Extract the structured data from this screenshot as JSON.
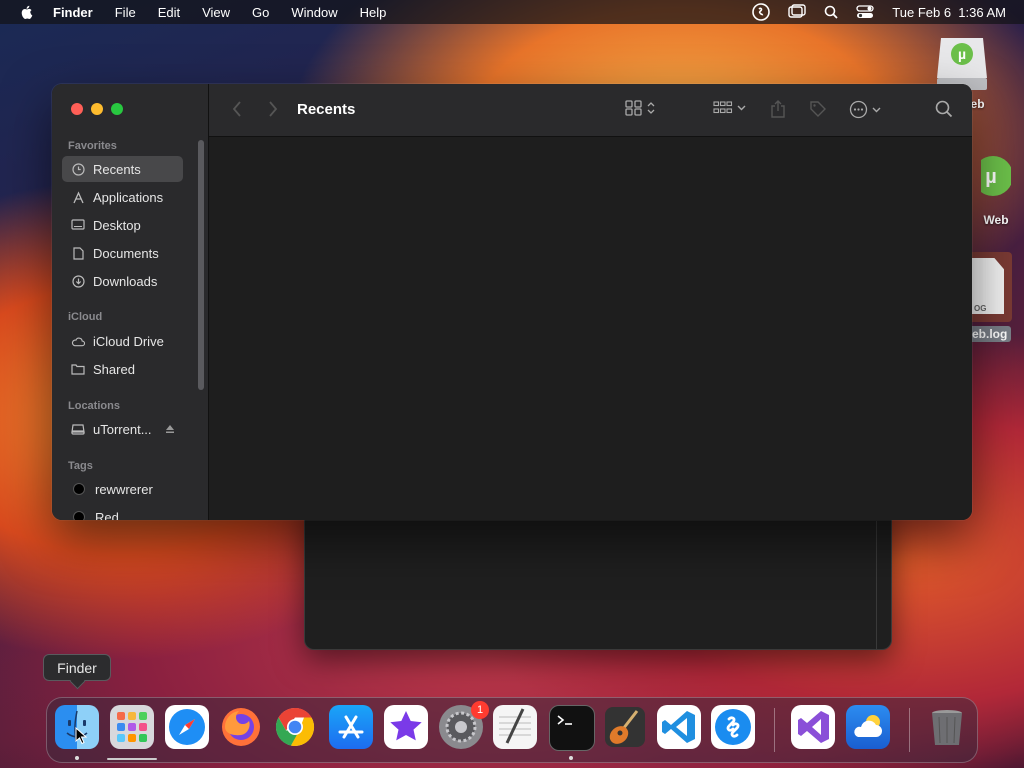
{
  "menubar": {
    "app_name": "Finder",
    "menus": [
      "File",
      "Edit",
      "View",
      "Go",
      "Window",
      "Help"
    ],
    "clock": "Tue Feb 6  1:36 AM"
  },
  "desktop": {
    "icons": [
      {
        "label": "Web"
      },
      {
        "label": "Web"
      },
      {
        "label": "eb.log",
        "doc_text": "OG"
      }
    ]
  },
  "finder": {
    "title": "Recents",
    "sidebar": {
      "favorites_header": "Favorites",
      "favorites": [
        "Recents",
        "Applications",
        "Desktop",
        "Documents",
        "Downloads"
      ],
      "icloud_header": "iCloud",
      "icloud": [
        "iCloud Drive",
        "Shared"
      ],
      "locations_header": "Locations",
      "locations": [
        "uTorrent..."
      ],
      "tags_header": "Tags",
      "tags": [
        {
          "label": "rewwrerer",
          "color": "#000000"
        },
        {
          "label": "Red",
          "color": "#000000"
        }
      ]
    }
  },
  "tooltip": "Finder",
  "dock": {
    "apps": [
      "Finder",
      "Launchpad",
      "Safari",
      "Firefox",
      "Chrome",
      "App Store",
      "iMovie",
      "System Settings",
      "TextEdit",
      "Terminal",
      "GarageBand",
      "Visual Studio Code",
      "Shazam",
      "Visual Studio",
      "Weather",
      "Trash"
    ],
    "settings_badge": "1"
  },
  "colors": {
    "close": "#ff5f57",
    "minimize": "#febc2e",
    "zoom": "#28c840",
    "sidebar_selection": "#48484a"
  }
}
